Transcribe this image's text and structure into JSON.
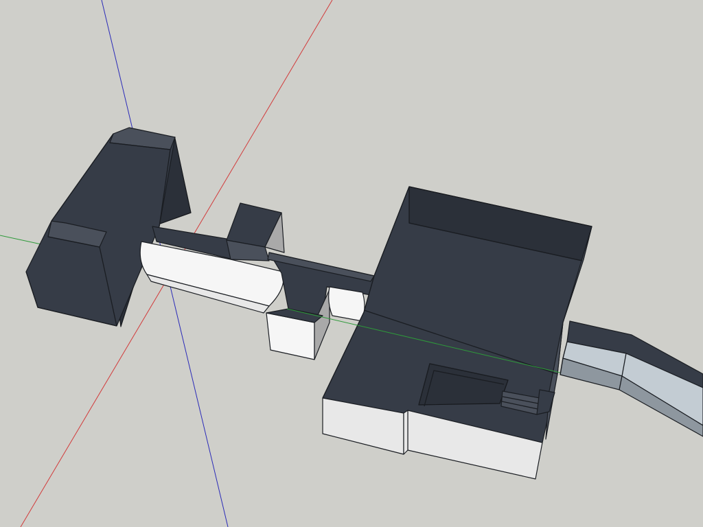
{
  "scene": {
    "background_color": "#cfcfca",
    "axes": {
      "red_axis_color": "#d23a3a",
      "green_axis_color": "#2e9a3a",
      "blue_axis_color": "#2a2ab8"
    },
    "colors": {
      "wall_dark": "#363c47",
      "face_light": "#e8e8e8",
      "ramp_blue": "#c3ccd3"
    }
  }
}
